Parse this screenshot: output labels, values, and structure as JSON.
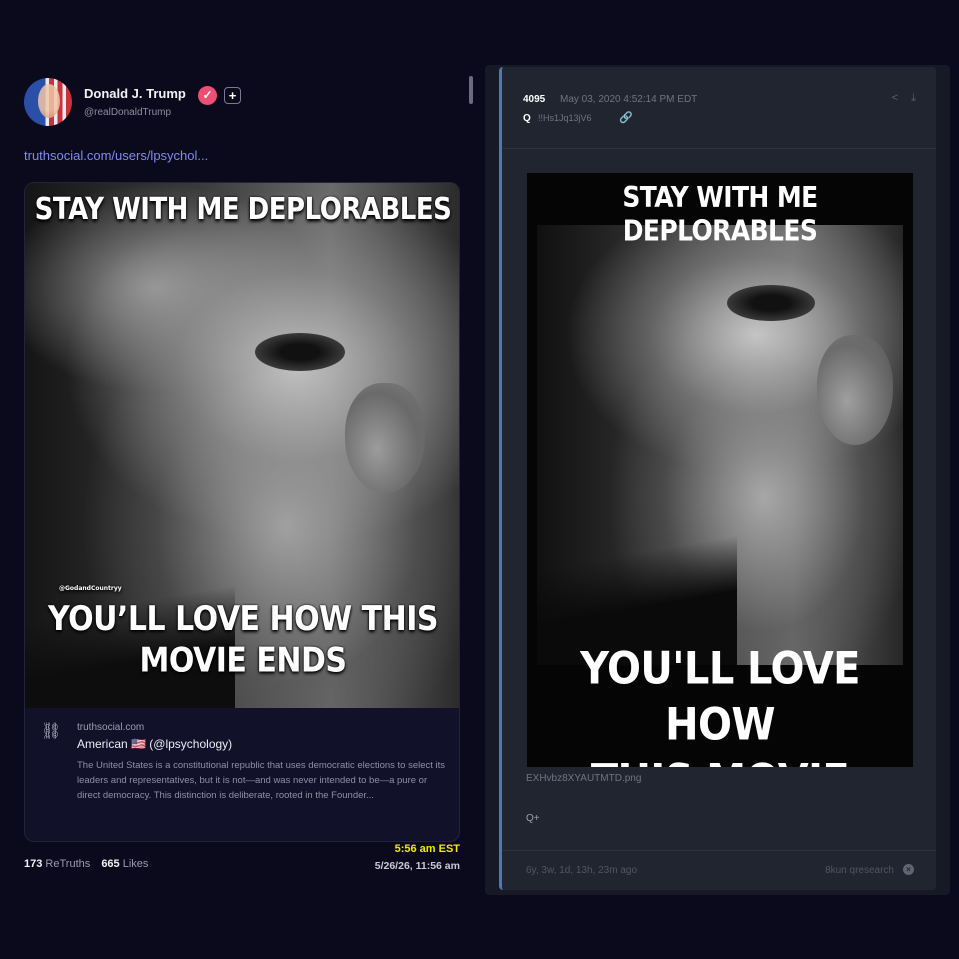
{
  "truth_post": {
    "author_name": "Donald J. Trump",
    "verified_glyph": "✓",
    "plus_glyph": "+",
    "handle": "@realDonaldTrump",
    "url": "truthsocial.com/users/lpsychol...",
    "meme": {
      "top_text": "STAY WITH ME DEPLORABLES",
      "watermark": "@GodandCountryy",
      "bottom_line1": "YOU’LL LOVE HOW THIS",
      "bottom_line2": "MOVIE ENDS"
    },
    "link_preview": {
      "domain": "truthsocial.com",
      "title": "American 🇺🇸 (@lpsychology)",
      "description": "The United States is a constitutional republic that uses democratic elections to select its leaders and representatives, but it is not—and was never intended to be—a pure or direct democracy. This distinction is deliberate, rooted in the Founder..."
    },
    "retruths_count": "173",
    "retruths_label": "ReTruths",
    "likes_count": "665",
    "likes_label": "Likes",
    "time_badge": "5:56 am EST",
    "date": "5/26/26, 11:56 am"
  },
  "q_post": {
    "post_number": "4095",
    "timestamp": "May 03, 2020 4:52:14 PM EDT",
    "name": "Q",
    "tripcode": "!!Hs1Jq13jV6",
    "meme": {
      "top_text": "STAY WITH ME DEPLORABLES",
      "bottom_line1": "YOU'LL LOVE HOW",
      "bottom_line2": "THIS MOVIE ENDS"
    },
    "filename": "EXHvbz8XYAUTMTD.png",
    "signature": "Q+",
    "age": "6y, 3w, 1d, 13h, 23m ago",
    "board": "8kun qresearch"
  },
  "icons": {
    "link": "link-icon",
    "share": "share-icon",
    "download": "download-icon",
    "chain": "chain-link-icon",
    "close": "close-circle-icon"
  },
  "colors": {
    "background": "#0b0a1c",
    "truth_link": "#7f8cf0",
    "verified_badge": "#ee4d74",
    "time_highlight": "#f5e800",
    "q_card": "#20252f",
    "q_accent": "#4a7bb5"
  }
}
